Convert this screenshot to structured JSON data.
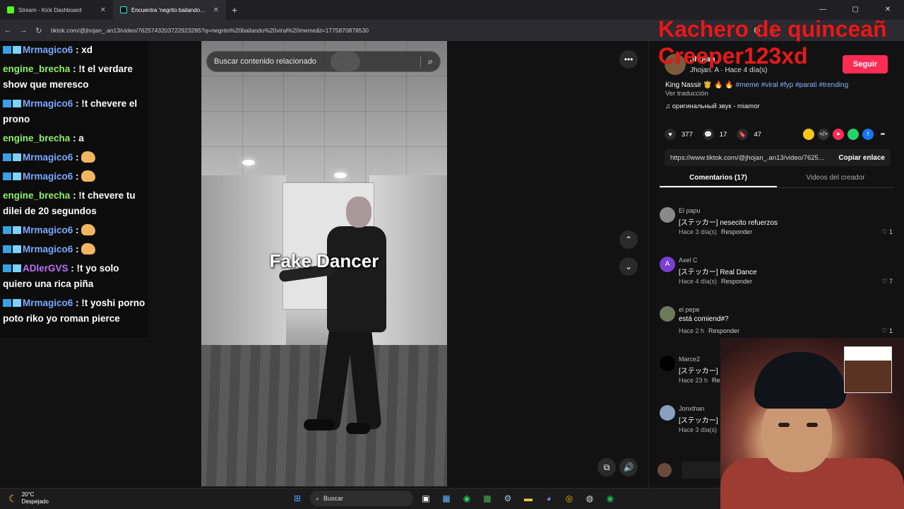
{
  "browser": {
    "tabs": [
      {
        "label": "Stream - Kick Dashboard"
      },
      {
        "label": "Encuentra 'negrito bailando…"
      }
    ],
    "new_tab": "+",
    "url": "tiktok.com/@jhojan_.an13/video/7625743203722923285?q=negrito%20bailando%20viral%20meme&t=1775870878530",
    "window_controls": [
      "—",
      "▢",
      "✕"
    ]
  },
  "chat": {
    "messages": [
      {
        "user": "Mrmagico6",
        "color": "blue",
        "badge": true,
        "text": ": xd"
      },
      {
        "user": "engine_brecha",
        "color": "green",
        "badge": false,
        "text": ": !t el verdare show que meresco"
      },
      {
        "user": "Mrmagico6",
        "color": "blue",
        "badge": true,
        "text": ": !t chevere el prono"
      },
      {
        "user": "engine_brecha",
        "color": "green",
        "badge": false,
        "text": ": a"
      },
      {
        "user": "Mrmagico6",
        "color": "blue",
        "badge": true,
        "text": ":",
        "emote": true
      },
      {
        "user": "Mrmagico6",
        "color": "blue",
        "badge": true,
        "text": ":",
        "emote": true
      },
      {
        "user": "engine_brecha",
        "color": "green",
        "badge": false,
        "text": ": !t chevere tu dilei de 20 segundos"
      },
      {
        "user": "Mrmagico6",
        "color": "blue",
        "badge": true,
        "text": ":",
        "emote": true
      },
      {
        "user": "Mrmagico6",
        "color": "blue",
        "badge": true,
        "text": ":",
        "emote": true
      },
      {
        "user": "ADlerGVS",
        "color": "purple",
        "badge": true,
        "text": ": !t yo solo quiero una rica piña"
      },
      {
        "user": "Mrmagico6",
        "color": "blue",
        "badge": true,
        "text": ": !t yoshi porno poto riko yo roman pierce"
      }
    ]
  },
  "video": {
    "search_placeholder": "Buscar contenido relacionado",
    "caption": "Fake Dancer"
  },
  "overlay_title": {
    "line1": "Kachero de quinceañ",
    "line2": "Creeper123xd"
  },
  "post": {
    "handle": "Jhojan",
    "meta": "Jhojan. A · Hace 4 día(s)",
    "follow_label": "Seguir",
    "description_prefix": "King Nassir 🤴 🔥 🔥",
    "hashtags": "#meme #viral #fyp #parati #trending",
    "translate": "Ver traducción",
    "sound": "♫ оригинальный звук - miamor",
    "likes": "377",
    "comments": "17",
    "saves": "47",
    "link": "https://www.tiktok.com/@jhojan_.an13/video/7625...",
    "copy_label": "Copiar enlace",
    "tab_comments": "Comentarios (17)",
    "tab_creator": "Videos del creador"
  },
  "comments": [
    {
      "name": "El papu",
      "text": "[ステッカー] nesecito refuerzos",
      "time": "Hace 3 día(s)",
      "reply": "Responder",
      "likes": "1",
      "initial": ""
    },
    {
      "name": "Axel C",
      "text": "[ステッカー] Real Dance",
      "time": "Hace 4 día(s)",
      "reply": "Responder",
      "likes": "7",
      "initial": "A"
    },
    {
      "name": "el pepe",
      "text": "está comiend#?",
      "time": "Hace 2 h",
      "reply": "Responder",
      "likes": "1",
      "initial": ""
    },
    {
      "name": "Marce2",
      "text": "[ステッカー]",
      "time": "Hace 23 h",
      "reply": "Re",
      "likes": "",
      "initial": ""
    },
    {
      "name": "Jonxthan",
      "text": "[ステッカー]",
      "time": "Hace 3 día(s)",
      "reply": "",
      "likes": "",
      "initial": ""
    }
  ],
  "taskbar": {
    "temp": "20°C",
    "condition": "Despejado",
    "search_label": "Buscar"
  },
  "colors": {
    "accent_red": "#fe2c55",
    "overlay_red": "#e21b1b",
    "chat_green": "#8ef06a",
    "chat_blue": "#79a8ff",
    "chat_purple": "#c070ff"
  }
}
